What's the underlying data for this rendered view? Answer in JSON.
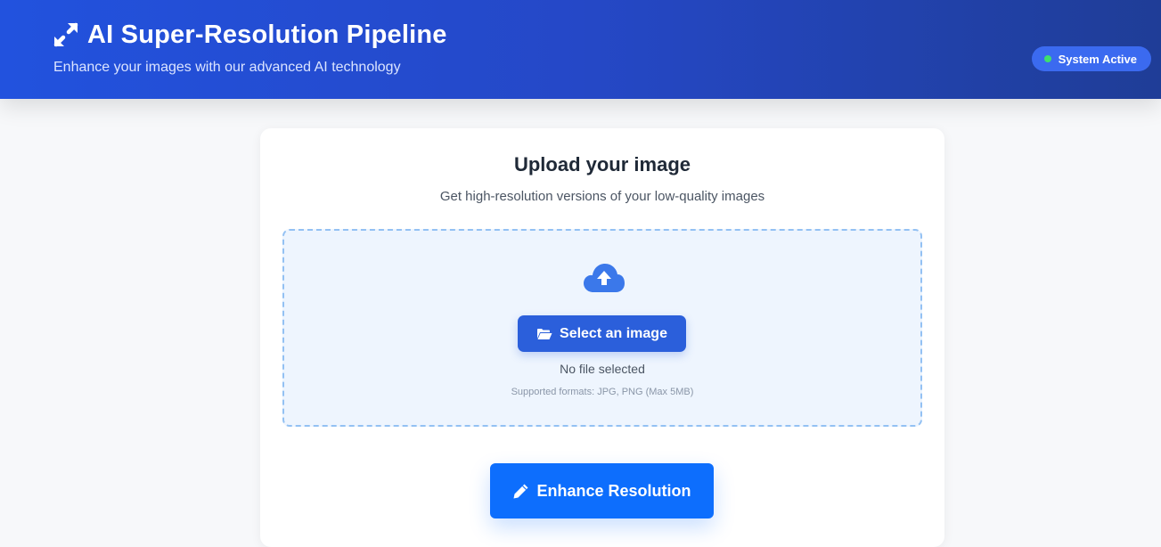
{
  "header": {
    "title": "AI Super-Resolution Pipeline",
    "subtitle": "Enhance your images with our advanced AI technology",
    "icon": "expand-arrows-icon",
    "status": {
      "label": "System Active",
      "dot_color": "#3ee06e"
    }
  },
  "upload": {
    "title": "Upload your image",
    "subtitle": "Get high-resolution versions of your low-quality images",
    "dropzone": {
      "icon": "cloud-upload-icon",
      "select_button_label": "Select an image",
      "select_button_icon": "folder-open-icon",
      "file_status": "No file selected",
      "formats_note": "Supported formats: JPG, PNG (Max 5MB)"
    },
    "enhance_button_label": "Enhance Resolution",
    "enhance_button_icon": "pencil-icon"
  },
  "colors": {
    "header_start": "#2252de",
    "header_end": "#1f3d97",
    "primary": "#0d6efd",
    "dropzone_bg": "#eef5fe",
    "dropzone_border": "#93c1f3"
  }
}
